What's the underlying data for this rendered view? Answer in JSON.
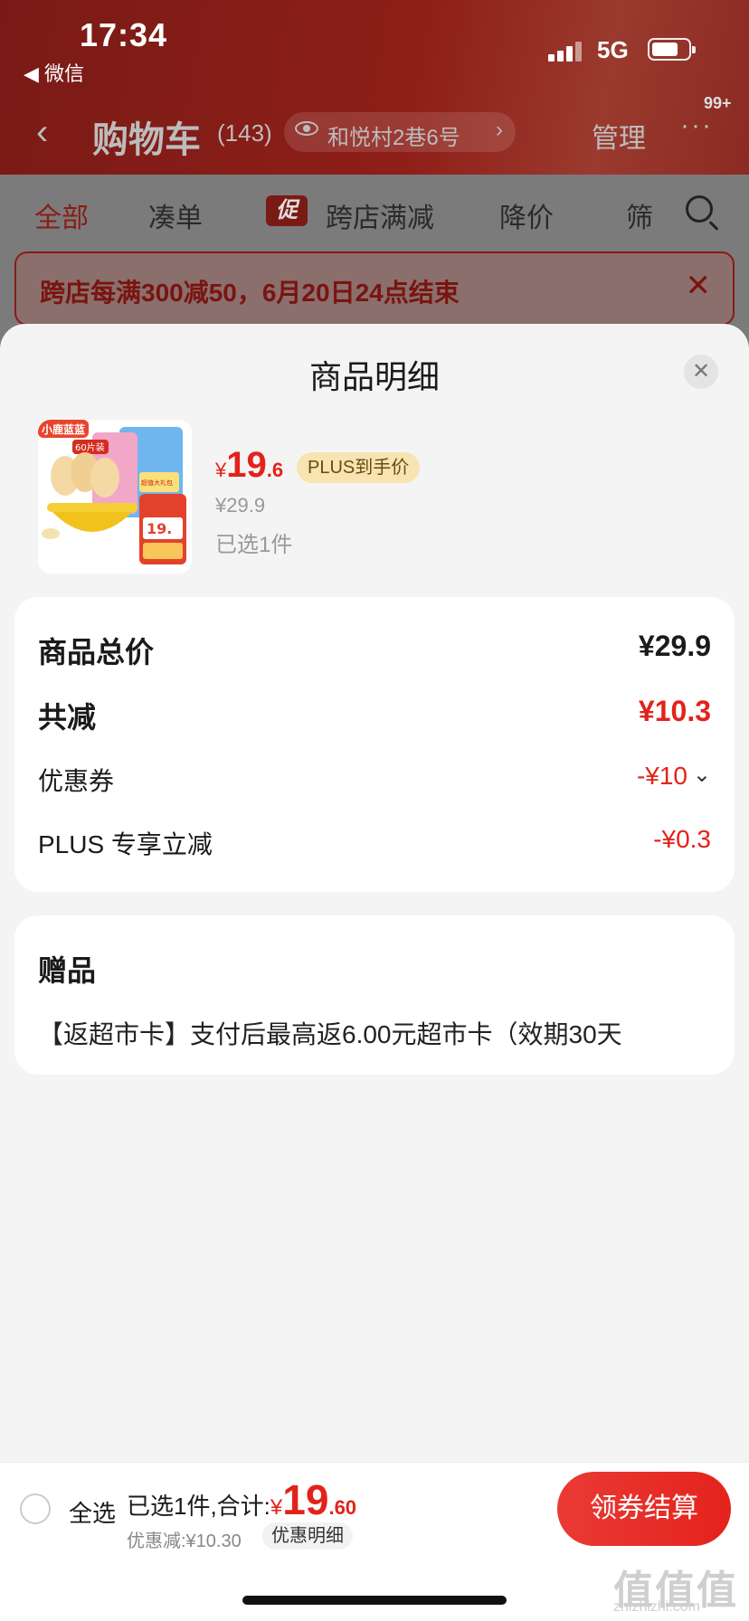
{
  "status": {
    "time": "17:34",
    "back_app": "◀ 微信",
    "network": "5G"
  },
  "navbar": {
    "back": "‹",
    "title": "购物车",
    "count": "(143)",
    "address": "和悦村2巷6号",
    "manage": "管理",
    "more": "···",
    "badge": "99+"
  },
  "filters": {
    "items": [
      "全部",
      "凑单",
      "跨店满减",
      "降价",
      "筛"
    ],
    "promo_tag": "促"
  },
  "notice": {
    "text": "跨店每满300减50，6月20日24点结束",
    "close": "✕"
  },
  "sheet": {
    "title": "商品明细",
    "close": "✕",
    "product": {
      "currency": "¥",
      "price_int": "19",
      "price_dec": ".6",
      "plus_label": "PLUS到手价",
      "original": "¥29.9",
      "qty": "已选1件",
      "image": {
        "brand": "小鹿蓝蓝",
        "badge": "60片装",
        "gift_banner": "超值大礼包",
        "price_tag": "19."
      }
    },
    "price_card": {
      "total_label": "商品总价",
      "total_value": "¥29.9",
      "reduce_label": "共减",
      "reduce_value": "¥10.3",
      "coupon_label": "优惠券",
      "coupon_value": "-¥10",
      "plus_label": "PLUS 专享立减",
      "plus_value": "-¥0.3"
    },
    "gift_card": {
      "title": "赠品",
      "text": "【返超市卡】支付后最高返6.00元超市卡（效期30天"
    }
  },
  "bottom_bar": {
    "select_all": "全选",
    "summary": "已选1件,合计:",
    "currency": "¥",
    "total_int": "19",
    "total_dec": ".60",
    "discount": "优惠减:¥10.30",
    "discount_detail": "优惠明细",
    "checkout": "领券结算"
  },
  "watermark": {
    "logo": "值值值",
    "url": "zhizhizhi.com"
  },
  "colors": {
    "accent": "#e2231a",
    "plus_tag": "#f7e4b2",
    "sheet_bg": "#f4f4f4"
  }
}
